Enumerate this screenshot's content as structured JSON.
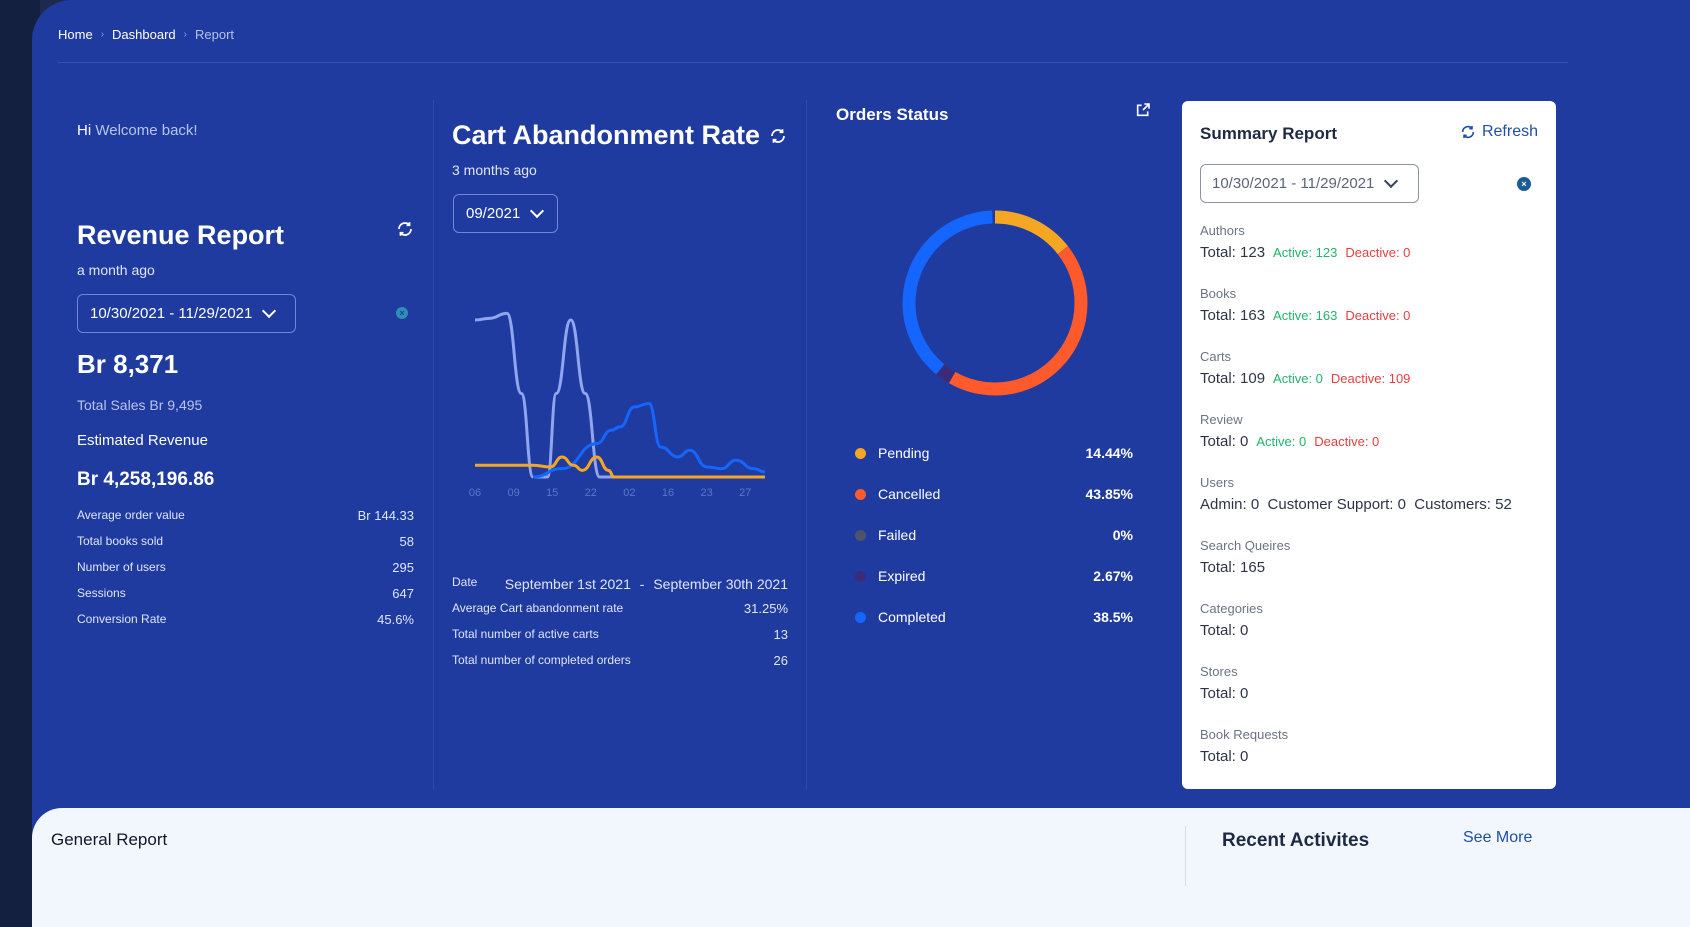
{
  "breadcrumb": [
    "Home",
    "Dashboard",
    "Report"
  ],
  "revenue": {
    "greeting_hi": "Hi",
    "greeting_msg": "Welcome back!",
    "title": "Revenue Report",
    "subtitle": "a month ago",
    "date_range": "10/30/2021 - 11/29/2021",
    "amount": "Br 8,371",
    "total_sales": "Total Sales Br 9,495",
    "estimated_label": "Estimated Revenue",
    "estimated_value": "Br 4,258,196.86",
    "stats": [
      {
        "label": "Average order value",
        "value": "Br 144.33"
      },
      {
        "label": "Total books sold",
        "value": "58"
      },
      {
        "label": "Number of users",
        "value": "295"
      },
      {
        "label": "Sessions",
        "value": "647"
      },
      {
        "label": "Conversion Rate",
        "value": "45.6%"
      }
    ]
  },
  "cart": {
    "title": "Cart Abandonment Rate",
    "subtitle": "3 months ago",
    "month": "09/2021",
    "date_label": "Date",
    "date_from": "September 1st 2021",
    "date_sep": "-",
    "date_to": "September 30th 2021",
    "stats": [
      {
        "label": "Average Cart abandonment rate",
        "value": "31.25%"
      },
      {
        "label": "Total number of active carts",
        "value": "13"
      },
      {
        "label": "Total number of completed orders",
        "value": "26"
      }
    ]
  },
  "chart_data": {
    "type": "line",
    "x_ticks": [
      "06",
      "09",
      "15",
      "22",
      "02",
      "16",
      "23",
      "27"
    ],
    "series": [
      {
        "color": "#8fa6ef",
        "values": [
          [
            0,
            0.94
          ],
          [
            0.05,
            0.95
          ],
          [
            0.11,
            0.98
          ],
          [
            0.16,
            0.5
          ],
          [
            0.2,
            0.0
          ],
          [
            0.25,
            0.0
          ],
          [
            0.28,
            0.5
          ],
          [
            0.33,
            0.94
          ],
          [
            0.38,
            0.5
          ],
          [
            0.43,
            0.0
          ],
          [
            0.48,
            0.0
          ]
        ]
      },
      {
        "color": "#1565ff",
        "values": [
          [
            0.2,
            0.0
          ],
          [
            0.3,
            0.05
          ],
          [
            0.42,
            0.2
          ],
          [
            0.47,
            0.28
          ],
          [
            0.5,
            0.3
          ],
          [
            0.55,
            0.42
          ],
          [
            0.6,
            0.44
          ],
          [
            0.64,
            0.18
          ],
          [
            0.7,
            0.12
          ],
          [
            0.74,
            0.16
          ],
          [
            0.8,
            0.06
          ],
          [
            0.85,
            0.05
          ],
          [
            0.9,
            0.1
          ],
          [
            0.96,
            0.05
          ],
          [
            1,
            0.03
          ]
        ]
      },
      {
        "color": "#f5a623",
        "values": [
          [
            0,
            0.07
          ],
          [
            0.2,
            0.07
          ],
          [
            0.26,
            0.06
          ],
          [
            0.3,
            0.12
          ],
          [
            0.34,
            0.07
          ],
          [
            0.37,
            0.04
          ],
          [
            0.42,
            0.12
          ],
          [
            0.46,
            0.04
          ],
          [
            0.48,
            0.0
          ],
          [
            1,
            0.0
          ]
        ]
      }
    ]
  },
  "orders": {
    "title": "Orders Status",
    "items": [
      {
        "label": "Pending",
        "value": "14.44%",
        "pct": 14.44,
        "color": "#f5a623"
      },
      {
        "label": "Cancelled",
        "value": "43.85%",
        "pct": 43.85,
        "color": "#ff5a2c"
      },
      {
        "label": "Failed",
        "value": "0%",
        "pct": 0,
        "color": "#4b5567"
      },
      {
        "label": "Expired",
        "value": "2.67%",
        "pct": 2.67,
        "color": "#3b2c7a"
      },
      {
        "label": "Completed",
        "value": "38.5%",
        "pct": 38.5,
        "color": "#1565ff"
      }
    ]
  },
  "summary": {
    "title": "Summary Report",
    "refresh": "Refresh",
    "date_range": "10/30/2021 - 11/29/2021",
    "sections": [
      {
        "label": "Authors",
        "total": "Total: 123",
        "active": "Active: 123",
        "deactive": "Deactive: 0"
      },
      {
        "label": "Books",
        "total": "Total: 163",
        "active": "Active: 163",
        "deactive": "Deactive: 0"
      },
      {
        "label": "Carts",
        "total": "Total: 109",
        "active": "Active: 0",
        "deactive": "Deactive: 109"
      },
      {
        "label": "Review",
        "total": "Total: 0",
        "active": "Active: 0",
        "deactive": "Deactive: 0"
      },
      {
        "label": "Users",
        "total": "Admin: 0  Customer Support: 0  Customers: 52"
      },
      {
        "label": "Search Queires",
        "total": "Total: 165"
      },
      {
        "label": "Categories",
        "total": "Total: 0"
      },
      {
        "label": "Stores",
        "total": "Total: 0"
      },
      {
        "label": "Book Requests",
        "total": "Total: 0"
      }
    ]
  },
  "bottom": {
    "general": "General Report",
    "recent": "Recent Activites",
    "see_more": "See More"
  }
}
